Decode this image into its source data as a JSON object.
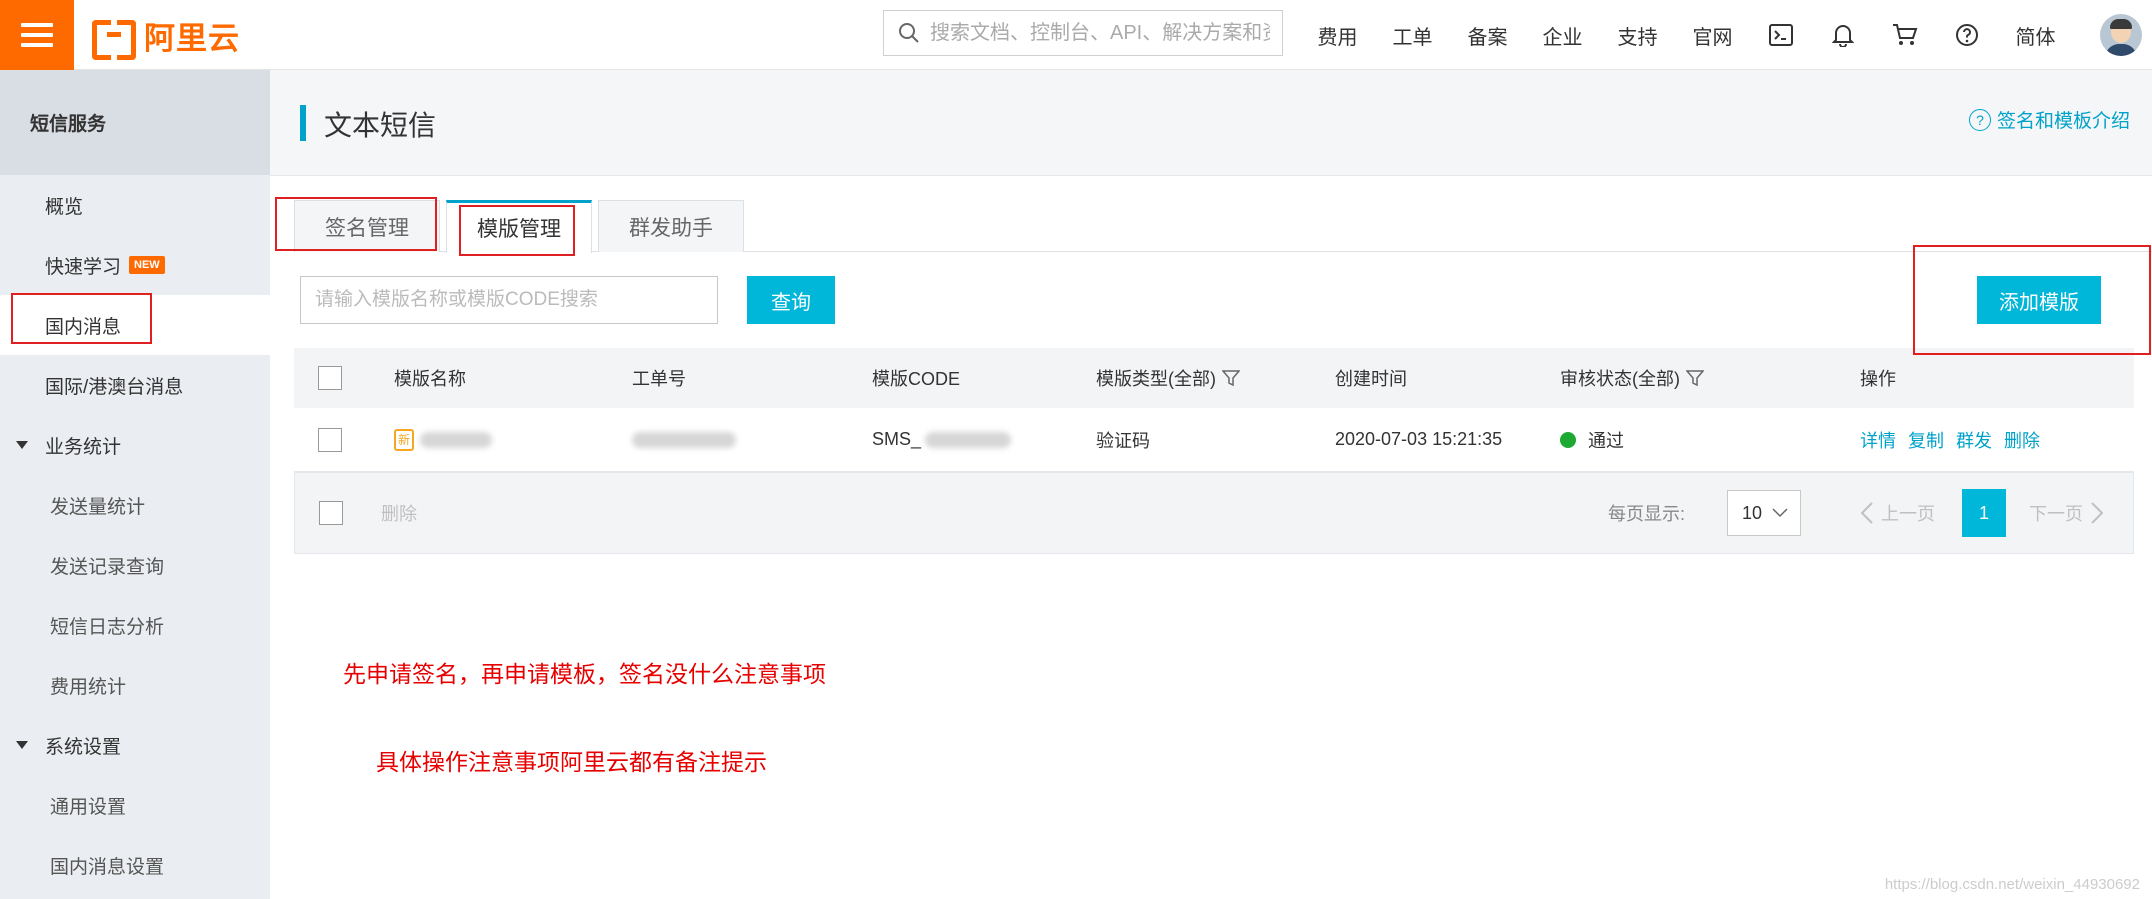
{
  "brand": {
    "name": "阿里云",
    "color": "#ff6a00",
    "accent": "#00b6d9"
  },
  "search": {
    "placeholder": "搜索文档、控制台、API、解决方案和资源"
  },
  "nav": {
    "items": [
      "费用",
      "工单",
      "备案",
      "企业",
      "支持",
      "官网"
    ],
    "icons": [
      "terminal-icon",
      "bell-icon",
      "cart-icon",
      "help-icon"
    ],
    "lang": "简体"
  },
  "sidebar": {
    "title": "短信服务",
    "items": [
      {
        "label": "概览"
      },
      {
        "label": "快速学习",
        "badge": "NEW"
      },
      {
        "label": "国内消息"
      },
      {
        "label": "国际/港澳台消息"
      }
    ],
    "groups": [
      {
        "label": "业务统计",
        "items": [
          "发送量统计",
          "发送记录查询",
          "短信日志分析",
          "费用统计"
        ]
      },
      {
        "label": "系统设置",
        "items": [
          "通用设置",
          "国内消息设置"
        ]
      }
    ]
  },
  "page": {
    "title": "文本短信",
    "help": "签名和模板介绍"
  },
  "tabs": [
    "签名管理",
    "模版管理",
    "群发助手"
  ],
  "active_tab": "模版管理",
  "filter": {
    "placeholder": "请输入模版名称或模版CODE搜索",
    "query_label": "查询",
    "add_label": "添加模版"
  },
  "table": {
    "columns": [
      "模版名称",
      "工单号",
      "模版CODE",
      "模版类型(全部)",
      "创建时间",
      "审核状态(全部)",
      "操作"
    ],
    "rows": [
      {
        "name": "",
        "ticket": "",
        "code": "SMS_",
        "type": "验证码",
        "created": "2020-07-03 15:21:35",
        "status": "通过",
        "status_color": "#1ea834",
        "actions": [
          "详情",
          "复制",
          "群发",
          "删除"
        ]
      }
    ]
  },
  "footer": {
    "delete_label": "删除",
    "per_page_label": "每页显示:",
    "per_page": "10",
    "prev": "上一页",
    "next": "下一页",
    "current_page": "1"
  },
  "notes": [
    "先申请签名，再申请模板，签名没什么注意事项",
    "具体操作注意事项阿里云都有备注提示"
  ],
  "watermark": "https://blog.csdn.net/weixin_44930692"
}
